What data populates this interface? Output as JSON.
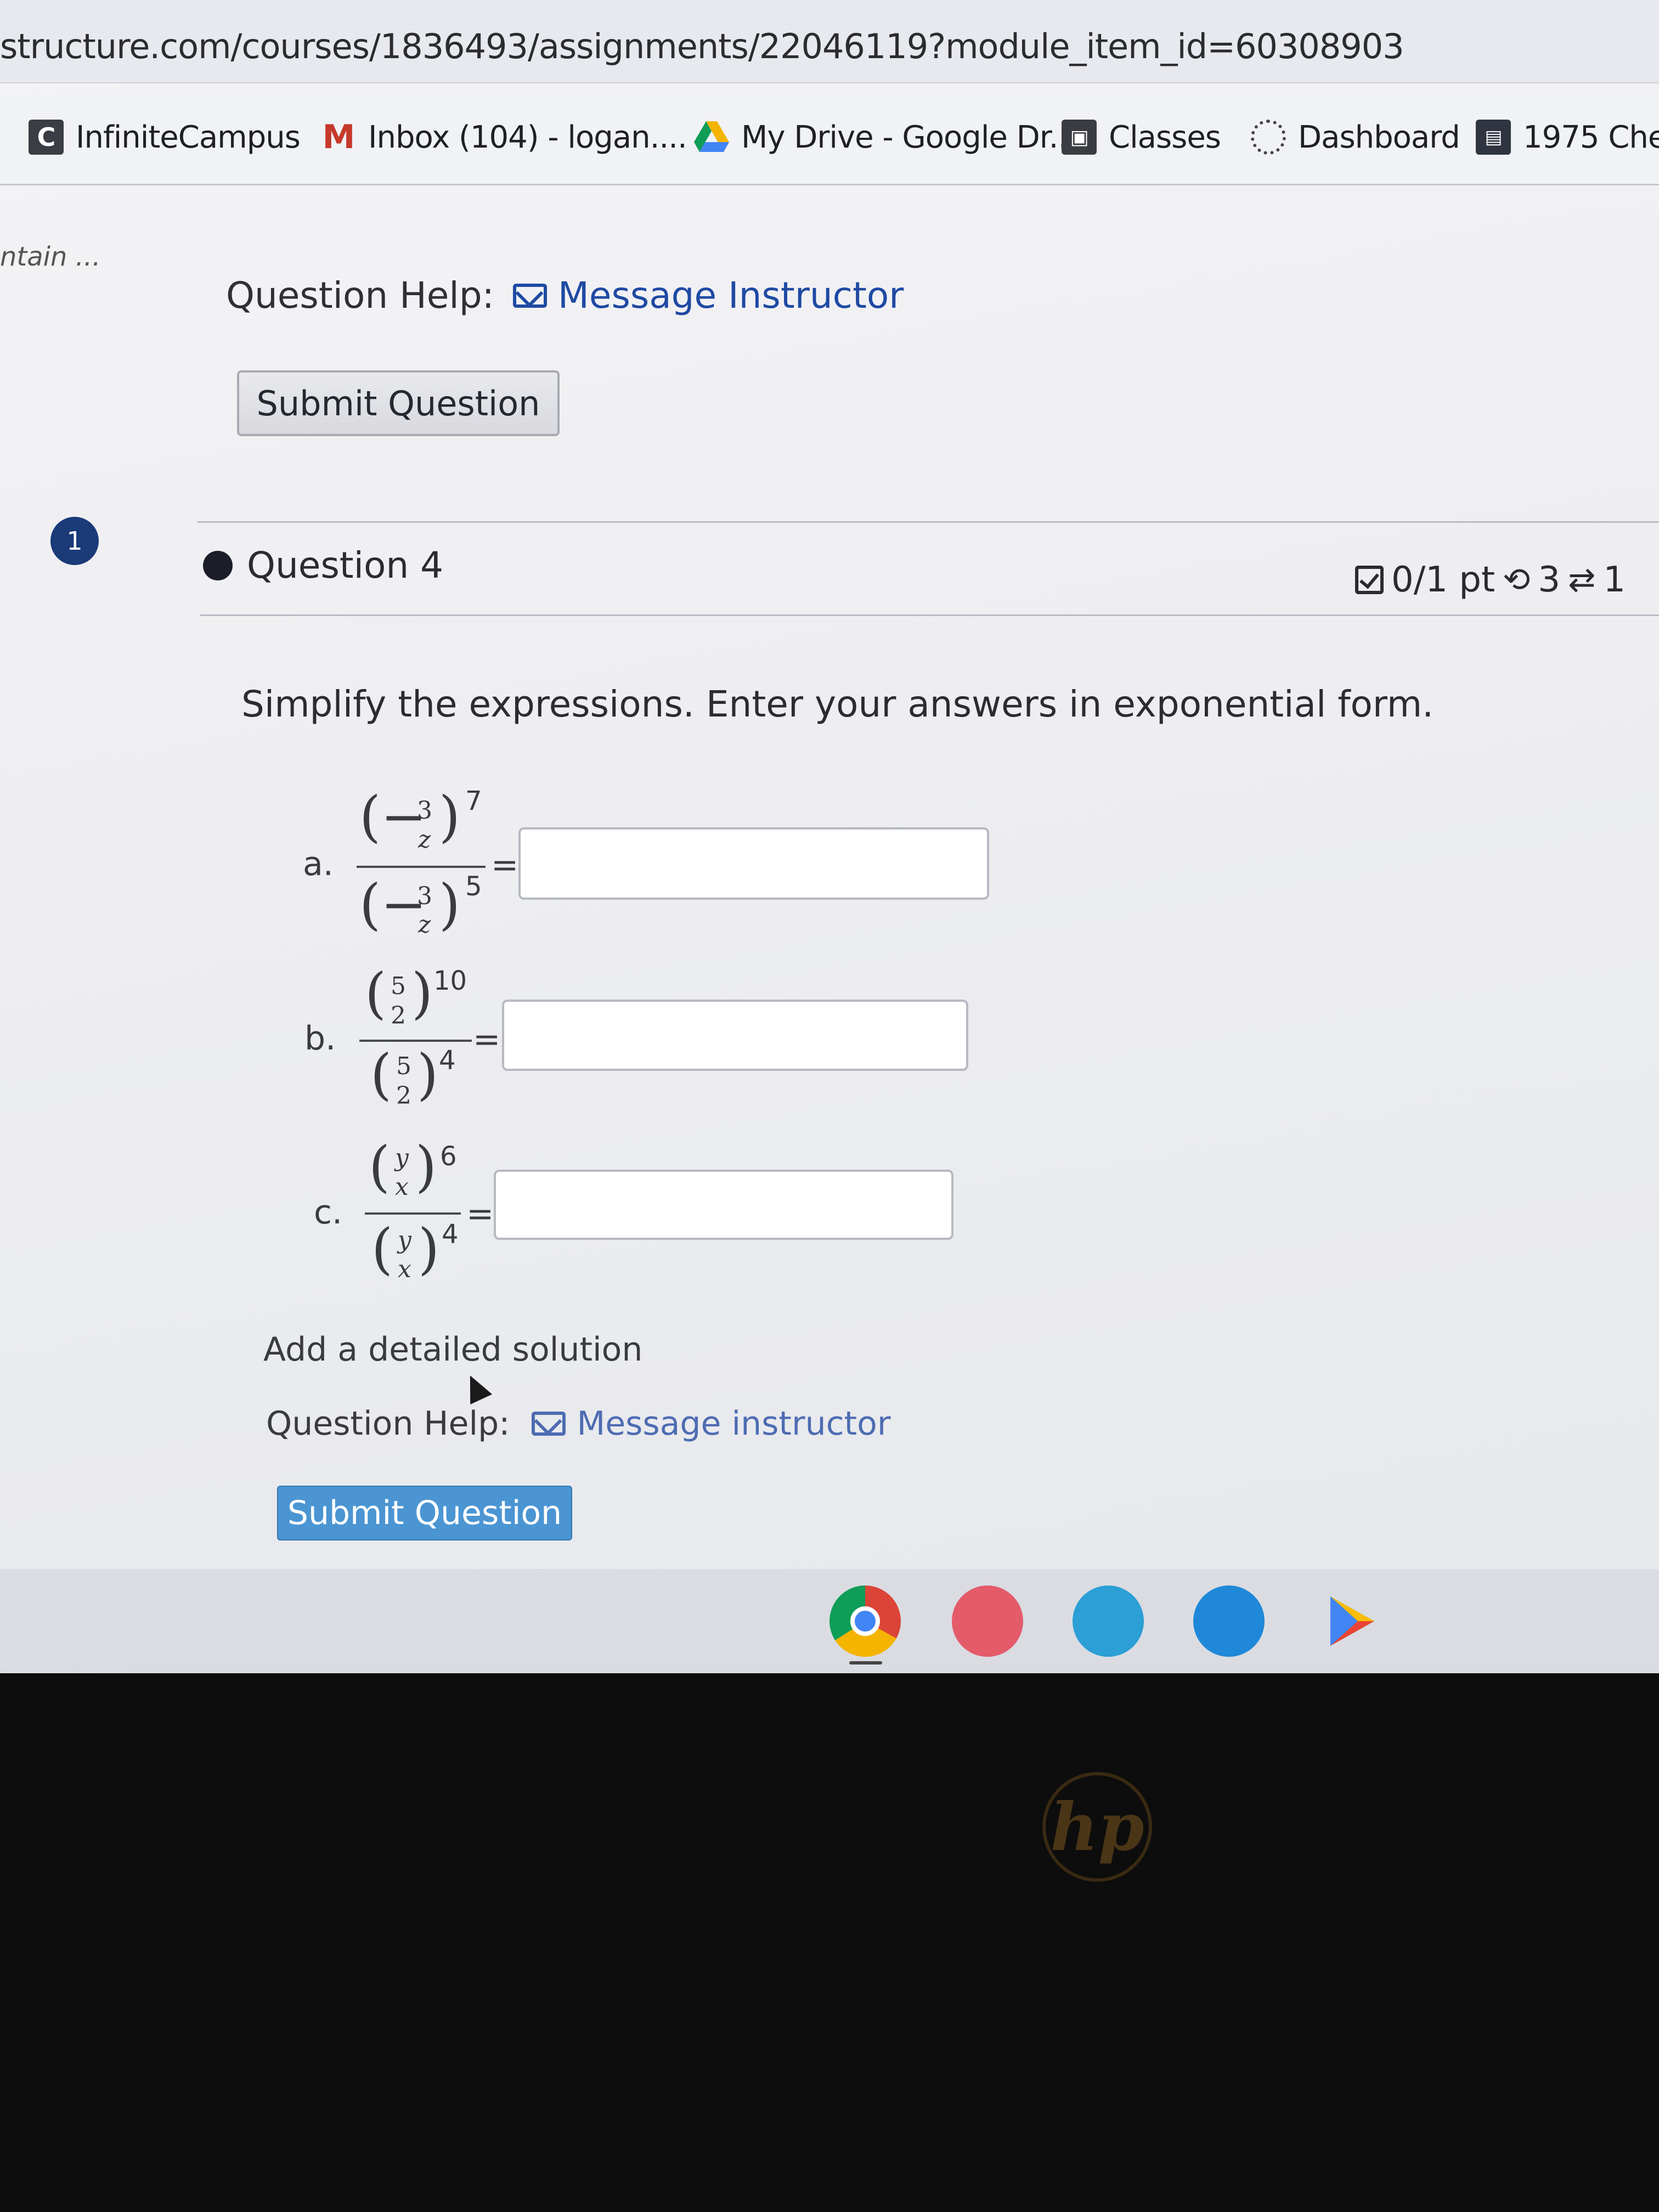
{
  "browser": {
    "url": "structure.com/courses/1836493/assignments/22046119?module_item_id=60308903",
    "tab_fragment": "ntain ...",
    "bookmarks": [
      {
        "label": "InfiniteCampus",
        "icon": "infinite-campus-icon"
      },
      {
        "label": "Inbox (104) - logan....",
        "icon": "gmail-icon"
      },
      {
        "label": "My Drive - Google Dr...",
        "icon": "google-drive-icon"
      },
      {
        "label": "Classes",
        "icon": "classes-icon"
      },
      {
        "label": "Dashboard",
        "icon": "dashboard-icon"
      },
      {
        "label": "1975 Chev",
        "icon": "bookmark-page-icon"
      }
    ]
  },
  "top": {
    "help_label": "Question Help:",
    "message_link": "Message Instructor",
    "submit_label": "Submit Question"
  },
  "question": {
    "badge": "1",
    "title": "Question 4",
    "score": "0/1 pt",
    "retries": "3",
    "attempts": "1",
    "instructions": "Simplify the expressions. Enter your answers in exponential form.",
    "parts": [
      {
        "label": "a.",
        "num_top": "3",
        "num_bot": "z",
        "sign": "−",
        "exp_top": "7",
        "exp_bot": "5",
        "answer": ""
      },
      {
        "label": "b.",
        "num_top": "5",
        "num_bot": "2",
        "sign": "",
        "exp_top": "10",
        "exp_bot": "4",
        "answer": ""
      },
      {
        "label": "c.",
        "num_top": "y",
        "num_bot": "x",
        "sign": "",
        "exp_top": "6",
        "exp_bot": "4",
        "answer": ""
      }
    ],
    "equals": "=",
    "detail_link": "Add a detailed solution",
    "help_label": "Question Help:",
    "message_link": "Message instructor",
    "submit_label": "Submit Question"
  },
  "shelf": {
    "apps": [
      "chrome-icon",
      "paint-icon",
      "classroom-icon",
      "files-icon",
      "play-store-icon"
    ]
  },
  "device": {
    "logo": "hp"
  }
}
